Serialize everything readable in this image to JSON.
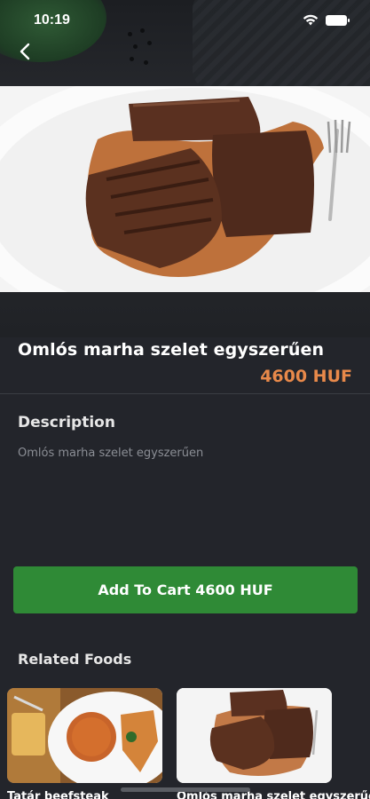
{
  "status_bar": {
    "time": "10:19",
    "icons": [
      "wifi-icon",
      "battery-icon"
    ]
  },
  "nav": {
    "back_icon": "chevron-left-icon"
  },
  "food": {
    "title": "Omlós marha szelet egyszerűen",
    "price": "4600 HUF",
    "image": "steak-plate-image"
  },
  "description": {
    "heading": "Description",
    "text": "Omlós marha szelet egyszerűen"
  },
  "cart": {
    "button_label": "Add To Cart 4600 HUF"
  },
  "related": {
    "heading": "Related Foods",
    "items": [
      {
        "name": "Tatár beefsteak",
        "image": "tartare-plate-image"
      },
      {
        "name": "Omlós marha szelet egyszerűen",
        "image": "steak-plate-image"
      }
    ]
  },
  "colors": {
    "background": "#23252b",
    "accent_price": "#e8894a",
    "button_green": "#2f8a36",
    "muted_text": "#8b8e95"
  }
}
